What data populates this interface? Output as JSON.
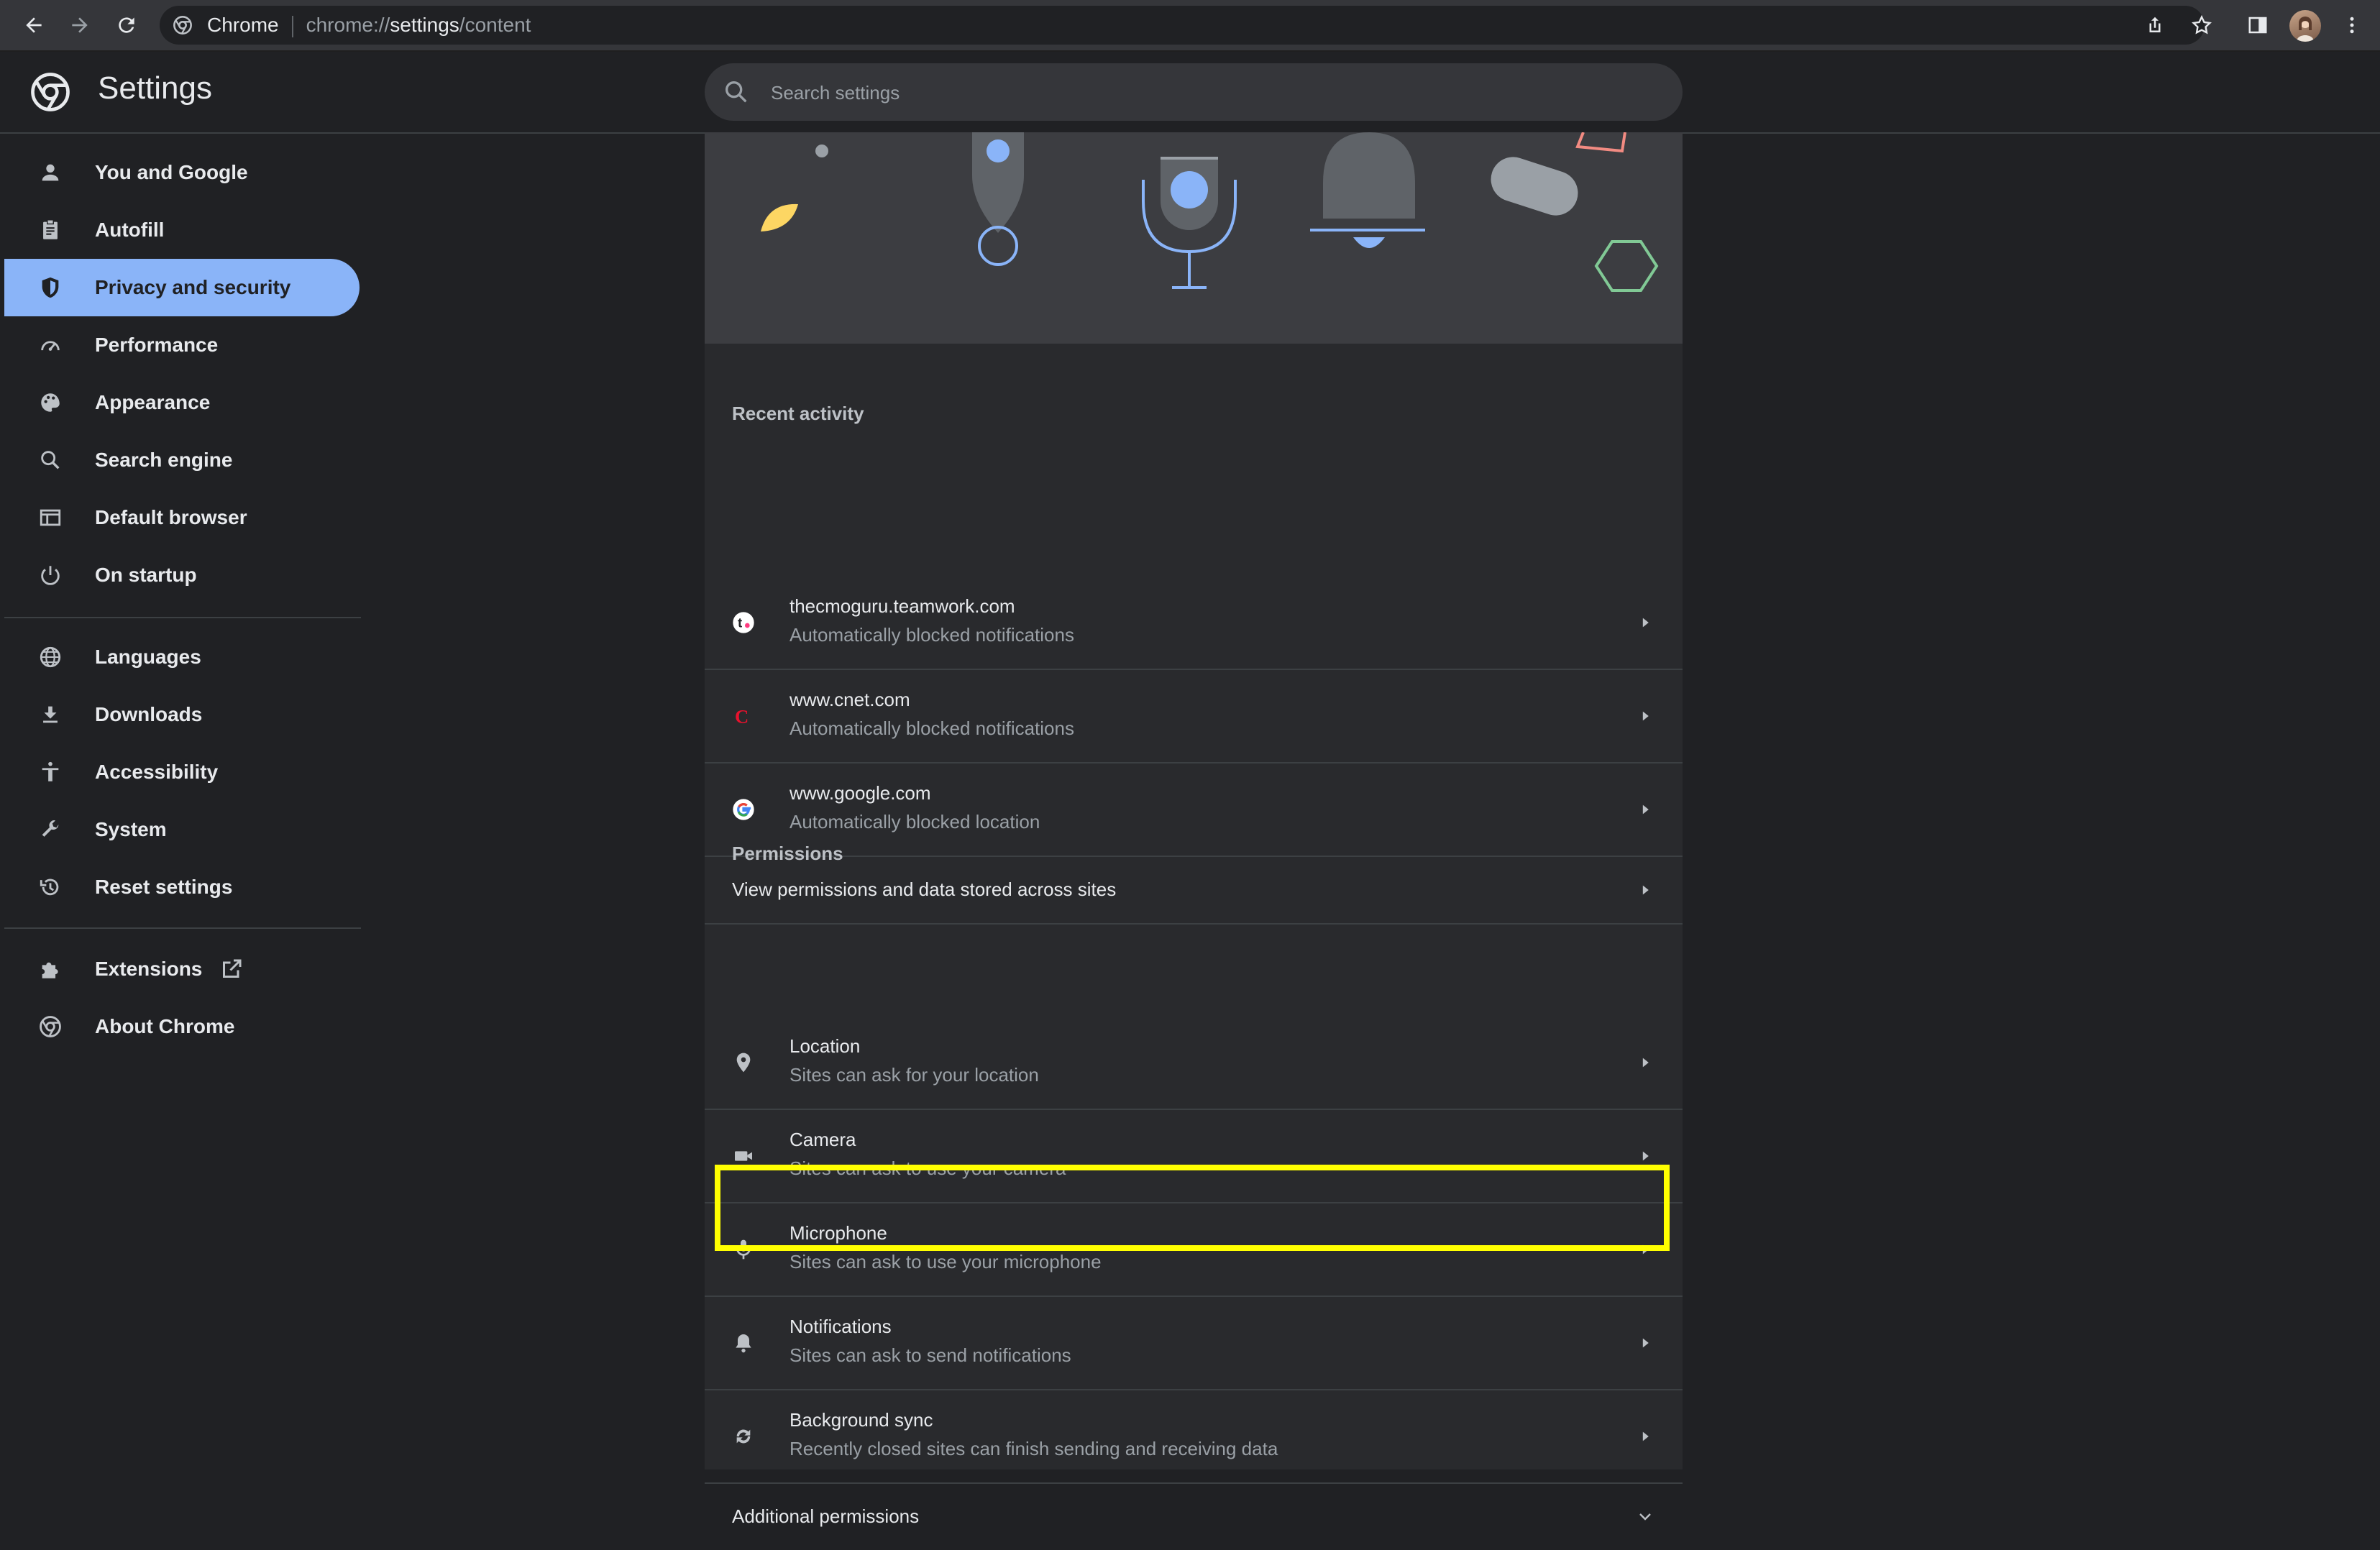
{
  "browser": {
    "omnibox_chip": "Chrome",
    "url_scheme": "chrome://",
    "url_host": "settings",
    "url_path": "/content",
    "icons": [
      "back-icon",
      "forward-icon",
      "reload-icon",
      "share-icon",
      "bookmark-star-icon",
      "side-panel-icon",
      "profile-avatar",
      "kebab-menu-icon"
    ]
  },
  "header": {
    "title": "Settings",
    "search_placeholder": "Search settings"
  },
  "sidebar": {
    "items": [
      {
        "label": "You and Google",
        "icon": "person-icon"
      },
      {
        "label": "Autofill",
        "icon": "clipboard-icon"
      },
      {
        "label": "Privacy and security",
        "icon": "shield-icon",
        "active": true
      },
      {
        "label": "Performance",
        "icon": "speedometer-icon"
      },
      {
        "label": "Appearance",
        "icon": "palette-icon"
      },
      {
        "label": "Search engine",
        "icon": "search-icon"
      },
      {
        "label": "Default browser",
        "icon": "browser-window-icon"
      },
      {
        "label": "On startup",
        "icon": "power-icon"
      },
      {
        "label": "Languages",
        "icon": "globe-icon"
      },
      {
        "label": "Downloads",
        "icon": "download-icon"
      },
      {
        "label": "Accessibility",
        "icon": "accessibility-icon"
      },
      {
        "label": "System",
        "icon": "wrench-icon"
      },
      {
        "label": "Reset settings",
        "icon": "history-icon"
      },
      {
        "label": "Extensions",
        "icon": "puzzle-icon"
      },
      {
        "label": "About Chrome",
        "icon": "chrome-icon"
      }
    ]
  },
  "recent_activity": {
    "label": "Recent activity",
    "items": [
      {
        "site": "thecmoguru.teamwork.com",
        "status": "Automatically blocked notifications",
        "icon": "teamwork-favicon"
      },
      {
        "site": "www.cnet.com",
        "status": "Automatically blocked notifications",
        "icon": "cnet-favicon"
      },
      {
        "site": "www.google.com",
        "status": "Automatically blocked location",
        "icon": "google-favicon"
      }
    ],
    "view_all": "View permissions and data stored across sites"
  },
  "permissions": {
    "label": "Permissions",
    "items": [
      {
        "title": "Location",
        "sub": "Sites can ask for your location",
        "icon": "location-pin-icon"
      },
      {
        "title": "Camera",
        "sub": "Sites can ask to use your camera",
        "icon": "camera-icon"
      },
      {
        "title": "Microphone",
        "sub": "Sites can ask to use your microphone",
        "icon": "microphone-icon"
      },
      {
        "title": "Notifications",
        "sub": "Sites can ask to send notifications",
        "icon": "bell-icon",
        "highlighted": true
      },
      {
        "title": "Background sync",
        "sub": "Recently closed sites can finish sending and receiving data",
        "icon": "sync-icon"
      }
    ],
    "additional": "Additional permissions"
  },
  "colors": {
    "accent": "#8ab4f8",
    "highlight": "#ffff00",
    "background": "#202124",
    "card": "#292a2d"
  }
}
